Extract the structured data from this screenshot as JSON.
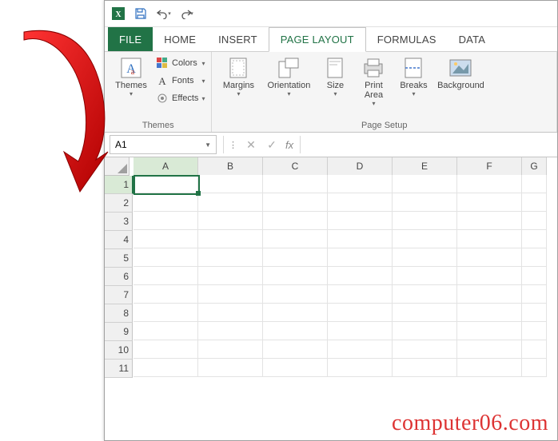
{
  "qat": {
    "save": "save",
    "undo": "undo",
    "redo": "redo"
  },
  "tabs": {
    "file": "FILE",
    "home": "HOME",
    "insert": "INSERT",
    "page_layout": "PAGE LAYOUT",
    "formulas": "FORMULAS",
    "data": "DATA"
  },
  "ribbon": {
    "themes_group": {
      "label": "Themes",
      "themes_btn": "Themes",
      "colors": "Colors",
      "fonts": "Fonts",
      "effects": "Effects"
    },
    "page_setup_group": {
      "label": "Page Setup",
      "margins": "Margins",
      "orientation": "Orientation",
      "size": "Size",
      "print_area": "Print\nArea",
      "breaks": "Breaks",
      "background": "Background"
    }
  },
  "formula_bar": {
    "name_box": "A1",
    "fx_label": "fx",
    "formula_value": ""
  },
  "grid": {
    "columns": [
      "A",
      "B",
      "C",
      "D",
      "E",
      "F",
      "G"
    ],
    "rows": [
      "1",
      "2",
      "3",
      "4",
      "5",
      "6",
      "7",
      "8",
      "9",
      "10",
      "11"
    ],
    "active_cell": "A1"
  },
  "watermark": "computer06.com"
}
